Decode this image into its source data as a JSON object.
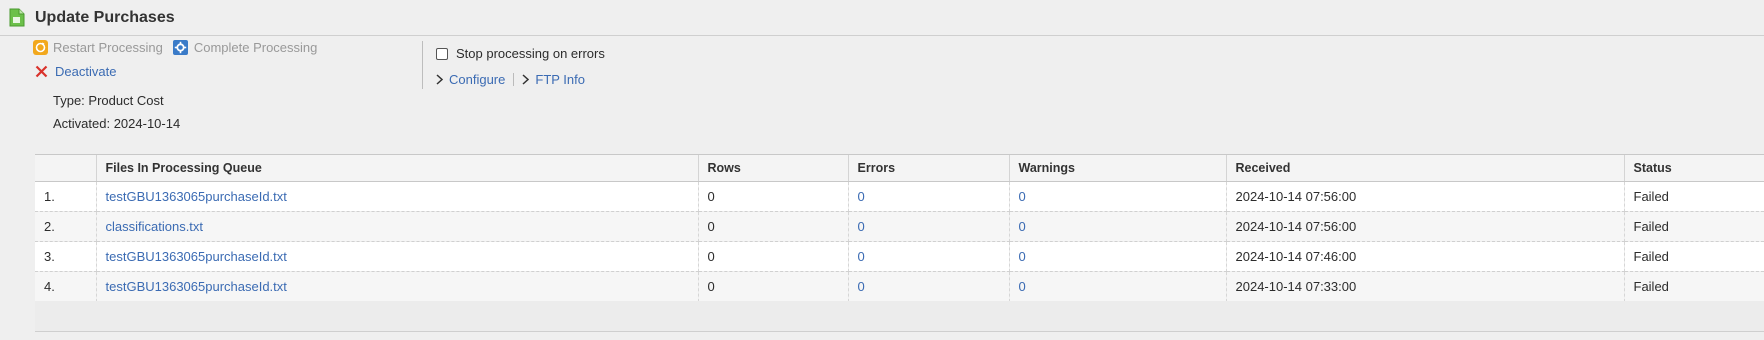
{
  "header": {
    "title": "Update Purchases"
  },
  "actions": {
    "restart": "Restart Processing",
    "complete": "Complete Processing",
    "deactivate": "Deactivate",
    "stop_on_errors": "Stop processing on errors",
    "configure": "Configure",
    "ftp_info": "FTP Info"
  },
  "info": {
    "type": "Type: Product Cost",
    "activated": "Activated: 2024-10-14"
  },
  "table": {
    "columns": [
      "Files In Processing Queue",
      "Rows",
      "Errors",
      "Warnings",
      "Received",
      "Status"
    ],
    "rows": [
      {
        "num": "1.",
        "file": "testGBU1363065purchaseId.txt",
        "rows": "0",
        "errors": "0",
        "warnings": "0",
        "received": "2024-10-14 07:56:00",
        "status": "Failed"
      },
      {
        "num": "2.",
        "file": "classifications.txt",
        "rows": "0",
        "errors": "0",
        "warnings": "0",
        "received": "2024-10-14 07:56:00",
        "status": "Failed"
      },
      {
        "num": "3.",
        "file": "testGBU1363065purchaseId.txt",
        "rows": "0",
        "errors": "0",
        "warnings": "0",
        "received": "2024-10-14 07:46:00",
        "status": "Failed"
      },
      {
        "num": "4.",
        "file": "testGBU1363065purchaseId.txt",
        "rows": "0",
        "errors": "0",
        "warnings": "0",
        "received": "2024-10-14 07:33:00",
        "status": "Failed"
      }
    ]
  },
  "colors": {
    "link": "#3b6bb3",
    "disabled": "#999999",
    "deactivate_icon": "#d9322b",
    "restart_icon": "#f2a81d",
    "complete_icon": "#3a7bc8"
  }
}
